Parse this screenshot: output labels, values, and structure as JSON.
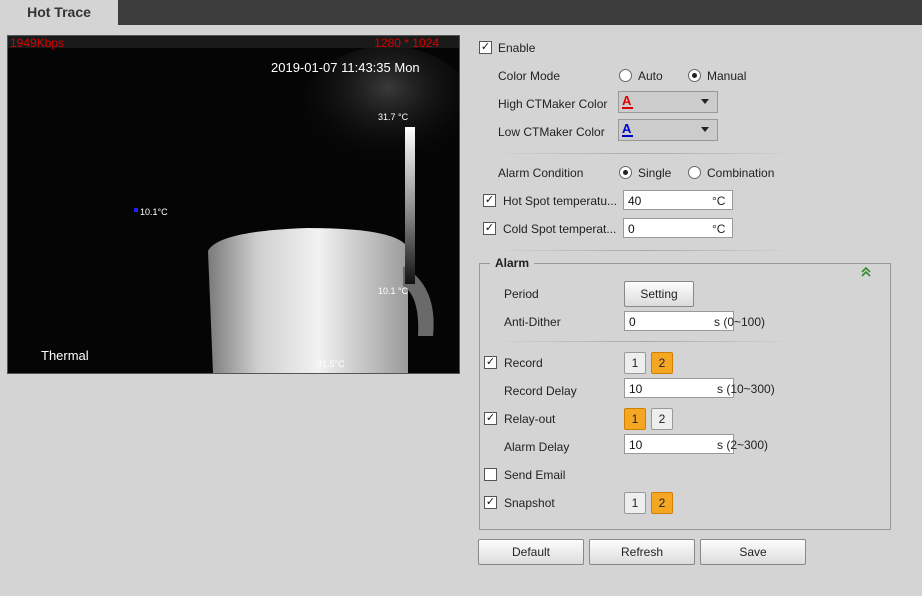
{
  "tab": {
    "title": "Hot Trace"
  },
  "video": {
    "bitrate": "1949Kbps",
    "resolution": "1280 * 1024",
    "timestamp": "2019-01-07 11:43:35 Mon",
    "channel_name": "Thermal",
    "scale_max": "31.7 °C",
    "scale_min": "10.1 °C",
    "cold_spot_label": "10.1°C",
    "hot_spot_label": "31.5°C"
  },
  "form": {
    "enable": {
      "label": "Enable",
      "checked": true
    },
    "color_mode": {
      "label": "Color Mode",
      "options": [
        "Auto",
        "Manual"
      ],
      "selected": "Manual"
    },
    "high_color": {
      "label": "High CTMaker Color",
      "letter": "A",
      "color": "#e00000"
    },
    "low_color": {
      "label": "Low CTMaker Color",
      "letter": "A",
      "color": "#0000cc"
    },
    "alarm_condition": {
      "label": "Alarm Condition",
      "options": [
        "Single",
        "Combination"
      ],
      "selected": "Single"
    },
    "hot_spot": {
      "label": "Hot Spot temperatu...",
      "value": "40",
      "unit": "°C",
      "checked": true
    },
    "cold_spot": {
      "label": "Cold Spot temperat...",
      "value": "0",
      "unit": "°C",
      "checked": true
    }
  },
  "alarm": {
    "title": "Alarm",
    "period": {
      "label": "Period",
      "button": "Setting"
    },
    "anti_dither": {
      "label": "Anti-Dither",
      "value": "0",
      "unit": "s (0~100)"
    },
    "record": {
      "label": "Record",
      "checked": true,
      "channels": [
        "1",
        "2"
      ],
      "active": [
        "2"
      ]
    },
    "record_delay": {
      "label": "Record Delay",
      "value": "10",
      "unit": "s (10~300)"
    },
    "relay_out": {
      "label": "Relay-out",
      "checked": true,
      "channels": [
        "1",
        "2"
      ],
      "active": [
        "1"
      ]
    },
    "alarm_delay": {
      "label": "Alarm Delay",
      "value": "10",
      "unit": "s (2~300)"
    },
    "send_email": {
      "label": "Send Email",
      "checked": false
    },
    "snapshot": {
      "label": "Snapshot",
      "checked": true,
      "channels": [
        "1",
        "2"
      ],
      "active": [
        "2"
      ]
    }
  },
  "buttons": {
    "default": "Default",
    "refresh": "Refresh",
    "save": "Save"
  }
}
